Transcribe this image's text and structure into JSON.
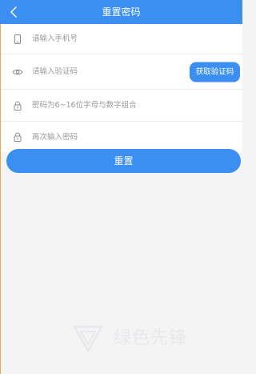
{
  "header": {
    "title": "重置密码",
    "back_icon": "chevron-left-icon"
  },
  "form": {
    "phone": {
      "placeholder": "请输入手机号",
      "value": "",
      "icon": "phone-icon"
    },
    "code": {
      "placeholder": "请输入验证码",
      "value": "",
      "icon": "eye-icon",
      "button_label": "获取验证码"
    },
    "password": {
      "placeholder": "密码为6~16位字母与数字组合",
      "value": "",
      "icon": "lock-icon"
    },
    "confirm": {
      "placeholder": "再次输入密码",
      "value": "",
      "icon": "lock-icon"
    }
  },
  "reset_button": {
    "label": "重置"
  },
  "watermark": {
    "text": "绿色先锋"
  },
  "colors": {
    "accent": "#3b8ff0",
    "background": "#f4f4f5",
    "panel": "#ffffff",
    "placeholder": "#9a9a9a"
  }
}
